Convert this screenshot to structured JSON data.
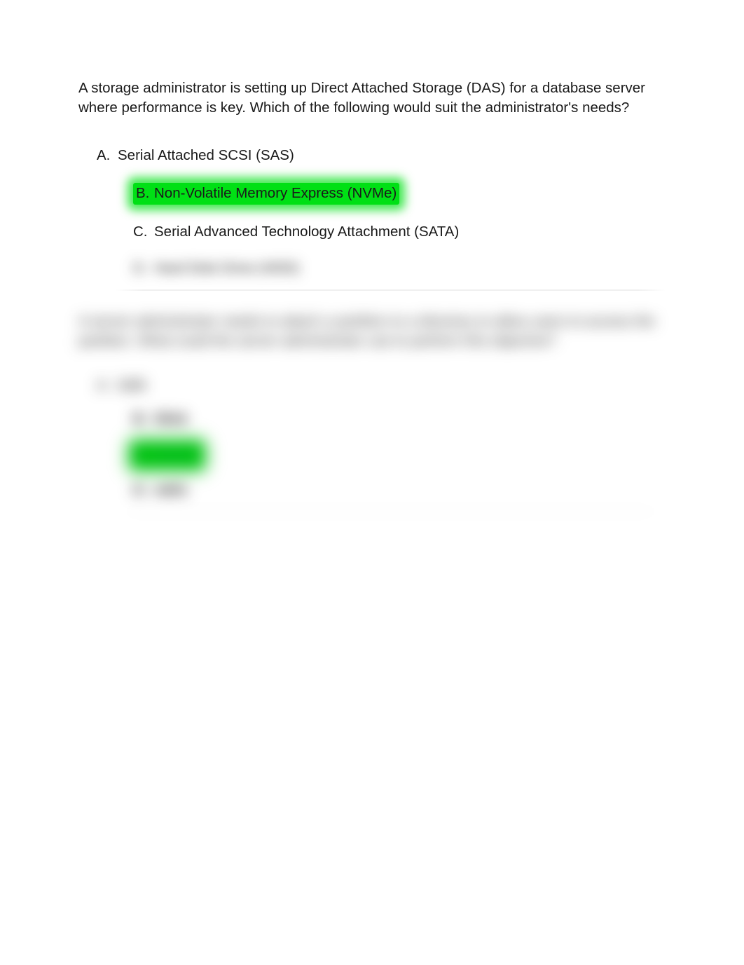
{
  "q1": {
    "prompt": "A storage administrator is setting up Direct Attached Storage (DAS) for a database server where performance is key. Which of the following would suit the administrator's needs?",
    "options": {
      "a": {
        "letter": "A.",
        "text": "Serial Attached SCSI (SAS)"
      },
      "b": {
        "letter": "B.",
        "text": "Non-Volatile Memory Express (NVMe)"
      },
      "c": {
        "letter": "C.",
        "text": "Serial Advanced Technology Attachment (SATA)"
      },
      "d": {
        "letter": "D.",
        "text": "Hard Disk Drive (HDD)"
      }
    }
  },
  "q2": {
    "prompt": "A server administrator needs to attach a partition to a directory to allow users to access the partition. What could the server administrator use to perform this objective?",
    "options": {
      "a": {
        "letter": "A.",
        "text": "lsblk"
      },
      "b": {
        "letter": "B.",
        "text": "fdisk"
      },
      "c": {
        "letter": "C.",
        "text": "mount"
      },
      "d": {
        "letter": "D.",
        "text": "mkfs"
      }
    }
  }
}
